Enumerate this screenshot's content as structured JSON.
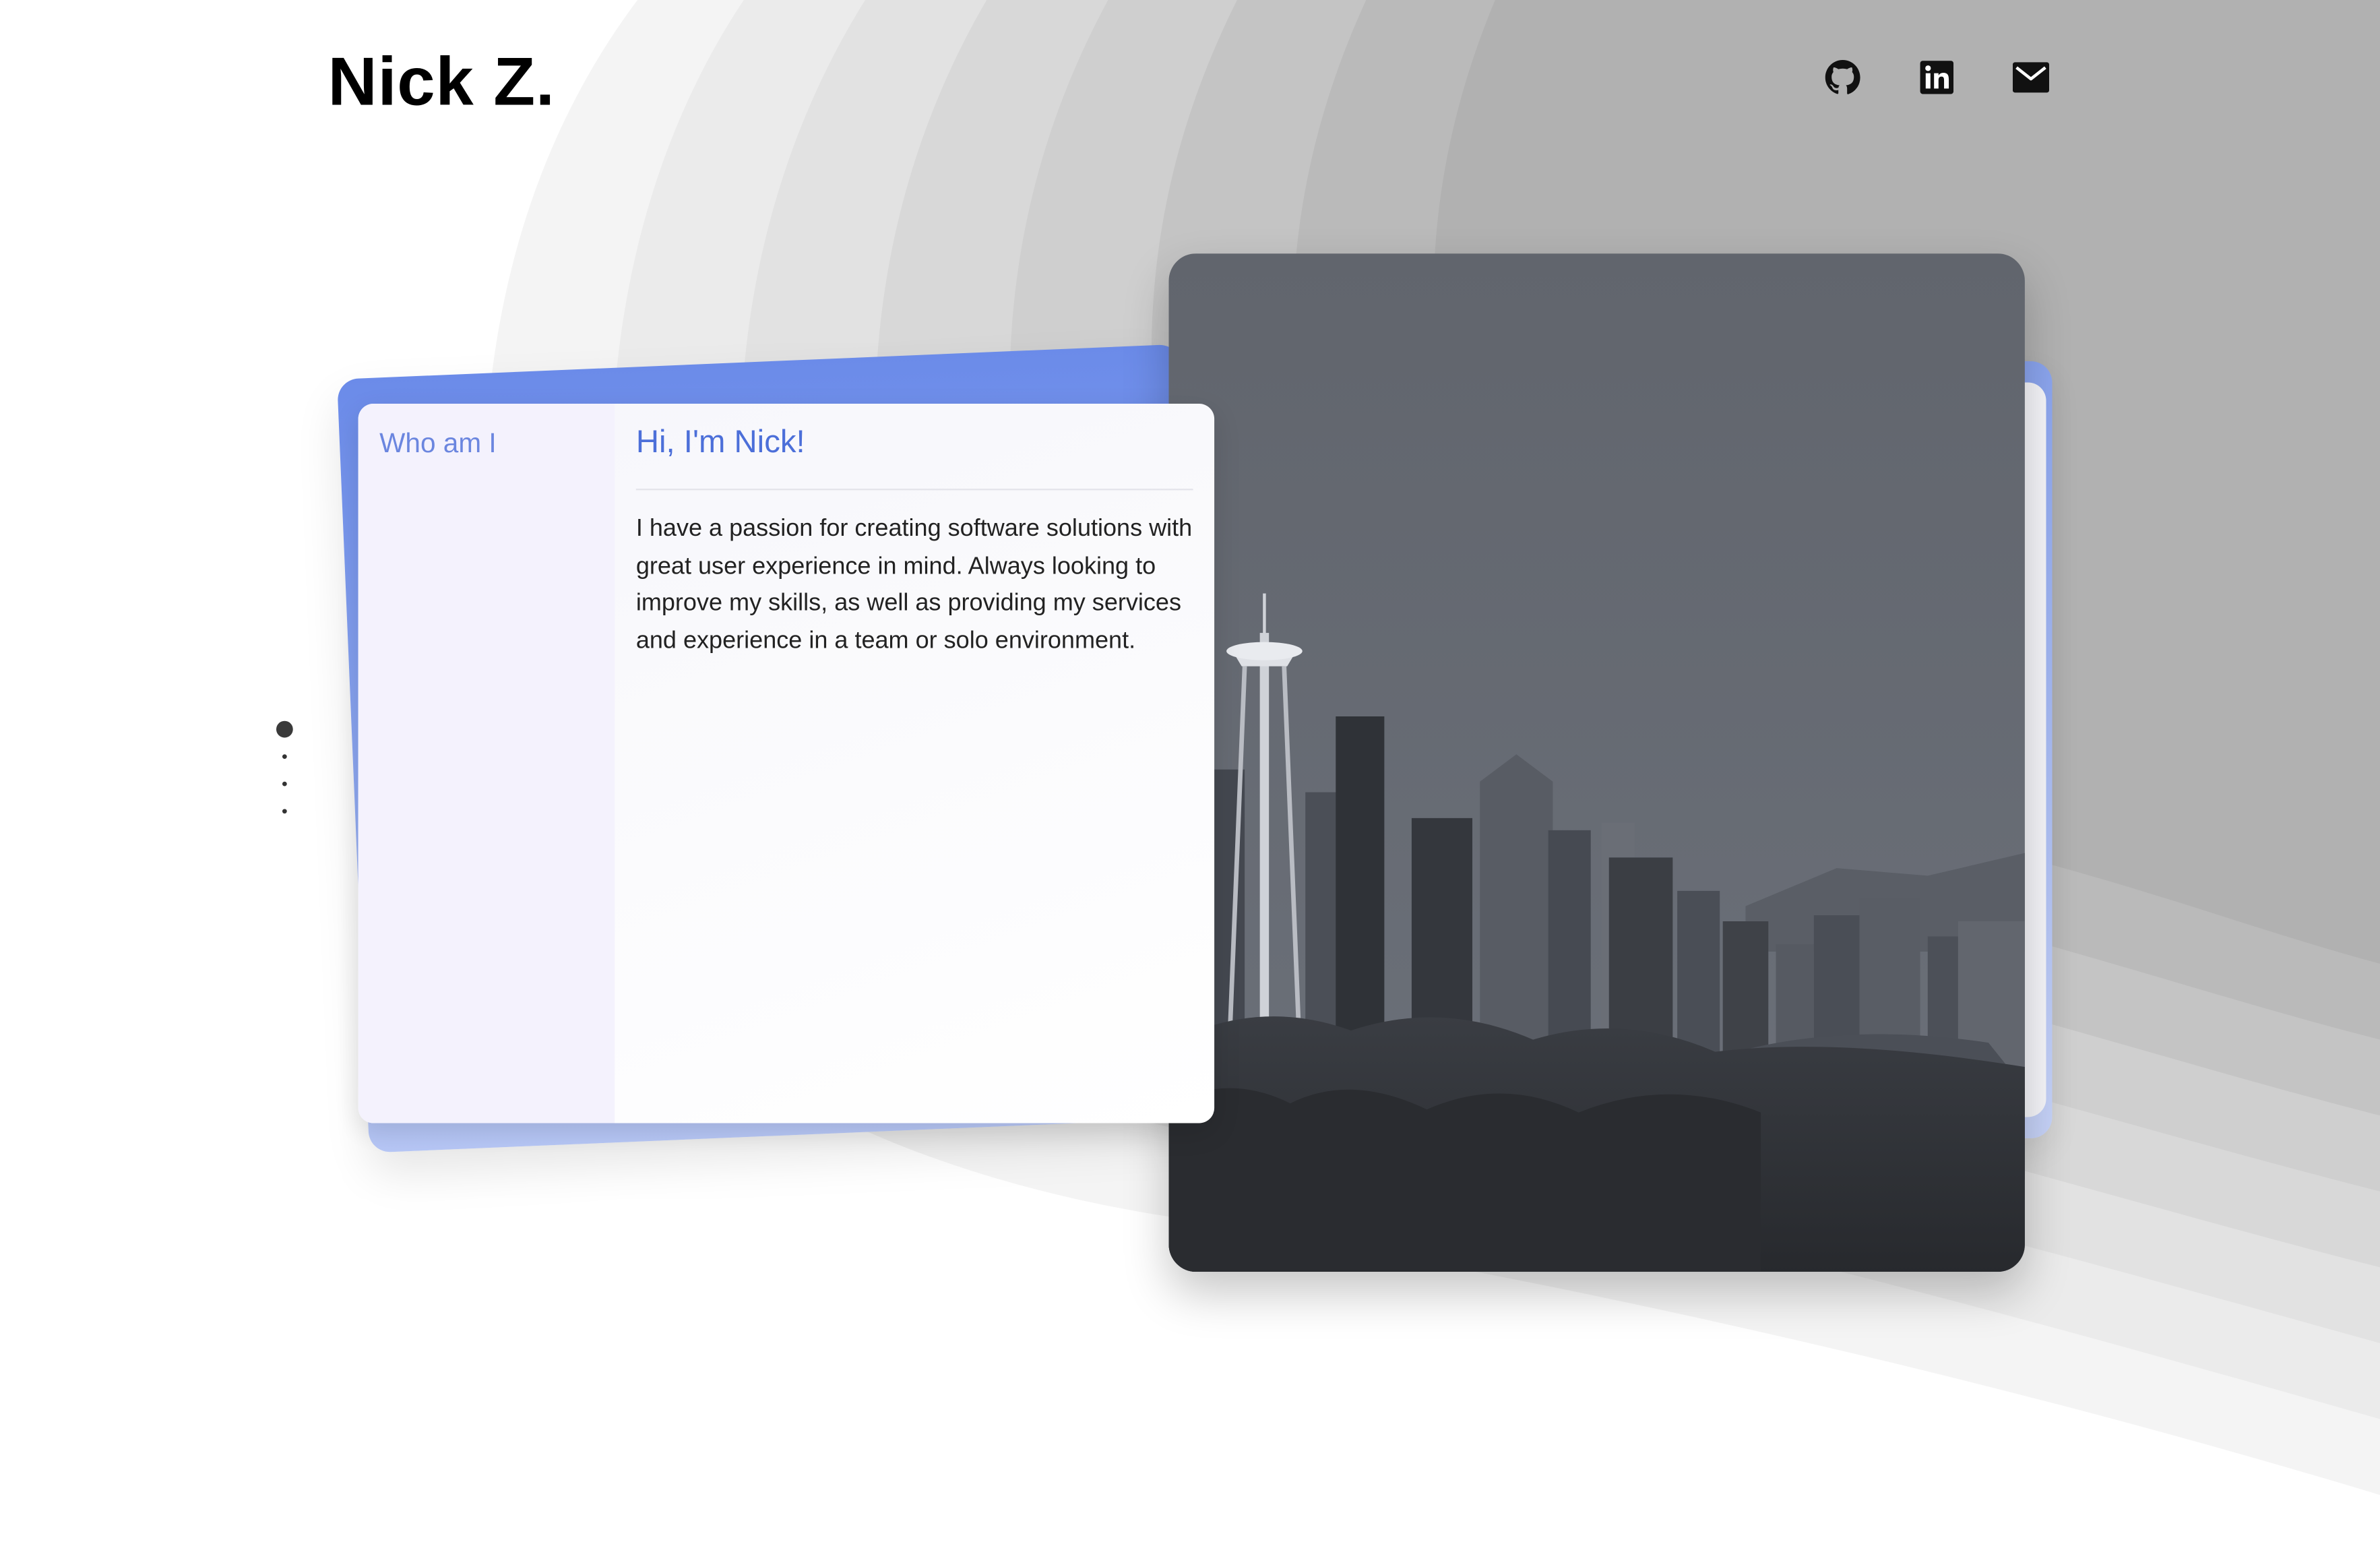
{
  "header": {
    "brand": "Nick Z.",
    "social": [
      {
        "icon": "github-icon",
        "label": "GitHub"
      },
      {
        "icon": "linkedin-icon",
        "label": "LinkedIn"
      },
      {
        "icon": "email-icon",
        "label": "Email"
      }
    ]
  },
  "about": {
    "side_label": "Who am I",
    "title": "Hi, I'm Nick!",
    "body": "I have a passion for creating software solutions with great user experience in mind. Always looking to improve my skills, as well as providing my services and experience in a team or solo environment."
  },
  "hero_image": {
    "subject": "seattle-skyline",
    "palette": [
      "#5f646d",
      "#2e3036"
    ]
  },
  "pager": {
    "count": 4,
    "active": 1
  },
  "colors": {
    "accent": "#4c6fd9",
    "accent_light": "#6b86df",
    "background_wave": "#b0b0b0"
  }
}
